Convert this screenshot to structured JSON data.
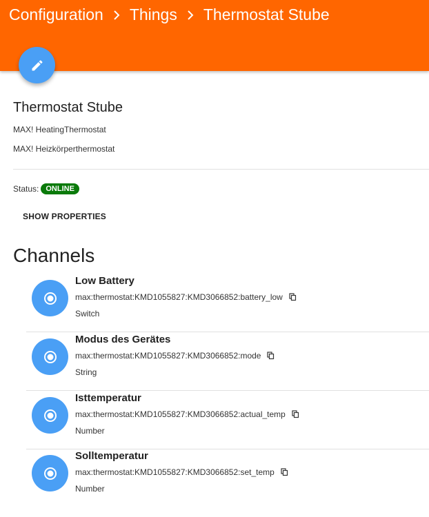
{
  "header": {
    "breadcrumb": [
      "Configuration",
      "Things",
      "Thermostat Stube"
    ],
    "color": "#ff6600"
  },
  "fab": {
    "icon": "pencil-icon"
  },
  "thing": {
    "title": "Thermostat Stube",
    "type_uid": "MAX! HeatingThermostat",
    "label": "MAX! Heizkörperthermostat",
    "status_label": "Status:",
    "status": "ONLINE",
    "show_properties": "SHOW PROPERTIES"
  },
  "channels": {
    "title": "Channels",
    "items": [
      {
        "name": "Low Battery",
        "uid": "max:thermostat:KMD1055827:KMD3066852:battery_low",
        "type": "Switch"
      },
      {
        "name": "Modus des Gerätes",
        "uid": "max:thermostat:KMD1055827:KMD3066852:mode",
        "type": "String"
      },
      {
        "name": "Isttemperatur",
        "uid": "max:thermostat:KMD1055827:KMD3066852:actual_temp",
        "type": "Number"
      },
      {
        "name": "Solltemperatur",
        "uid": "max:thermostat:KMD1055827:KMD3066852:set_temp",
        "type": "Number"
      }
    ]
  },
  "colors": {
    "accent": "#4a9ff5",
    "online": "#0a7a0a"
  }
}
